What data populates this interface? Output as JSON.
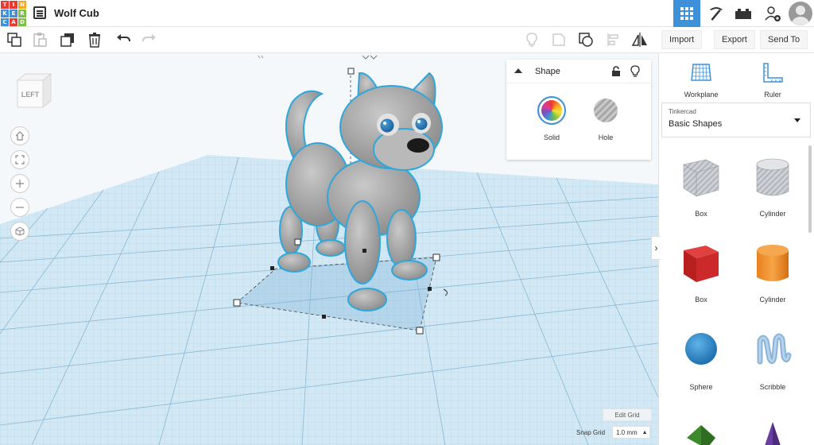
{
  "app": {
    "logo_letters": [
      "T",
      "I",
      "N",
      "K",
      "E",
      "R",
      "C",
      "A",
      "D"
    ],
    "logo_colors": [
      "#e83a30",
      "#e83a30",
      "#f5a623",
      "#3e91d9",
      "#3e91d9",
      "#7ac143",
      "#3e91d9",
      "#e83a30",
      "#7ac143"
    ],
    "project_title": "Wolf Cub",
    "accent_color": "#3e91d9"
  },
  "topright": {
    "icons": [
      "grid-view-icon",
      "pickaxe-icon",
      "bricks-icon",
      "add-user-icon",
      "avatar"
    ]
  },
  "toolbar": {
    "left_tools": [
      "copy-icon",
      "paste-icon",
      "duplicate-icon",
      "delete-icon",
      "undo-icon",
      "redo-icon"
    ],
    "right_tools": [
      "note-lightbulb-icon",
      "notes-icon",
      "workplane-shape-icon",
      "align-icon",
      "mirror-icon"
    ],
    "import_label": "Import",
    "export_label": "Export",
    "sendto_label": "Send To"
  },
  "viewport": {
    "viewcube_label": "LEFT",
    "nav": [
      "home-icon",
      "fit-icon",
      "zoom-in-icon",
      "zoom-out-icon",
      "perspective-icon"
    ]
  },
  "shape_panel": {
    "title": "Shape",
    "solid_label": "Solid",
    "hole_label": "Hole"
  },
  "right_panel": {
    "workplane_label": "Workplane",
    "ruler_label": "Ruler",
    "library_small": "Tinkercad",
    "library_name": "Basic Shapes",
    "shapes": [
      {
        "label": "Box",
        "kind": "box-gray"
      },
      {
        "label": "Cylinder",
        "kind": "cyl-gray"
      },
      {
        "label": "Box",
        "kind": "box-red"
      },
      {
        "label": "Cylinder",
        "kind": "cyl-orange"
      },
      {
        "label": "Sphere",
        "kind": "sphere"
      },
      {
        "label": "Scribble",
        "kind": "scribble"
      }
    ]
  },
  "grid_controls": {
    "edit_grid_label": "Edit Grid",
    "snap_label": "Snap Grid",
    "snap_value": "1.0 mm"
  }
}
